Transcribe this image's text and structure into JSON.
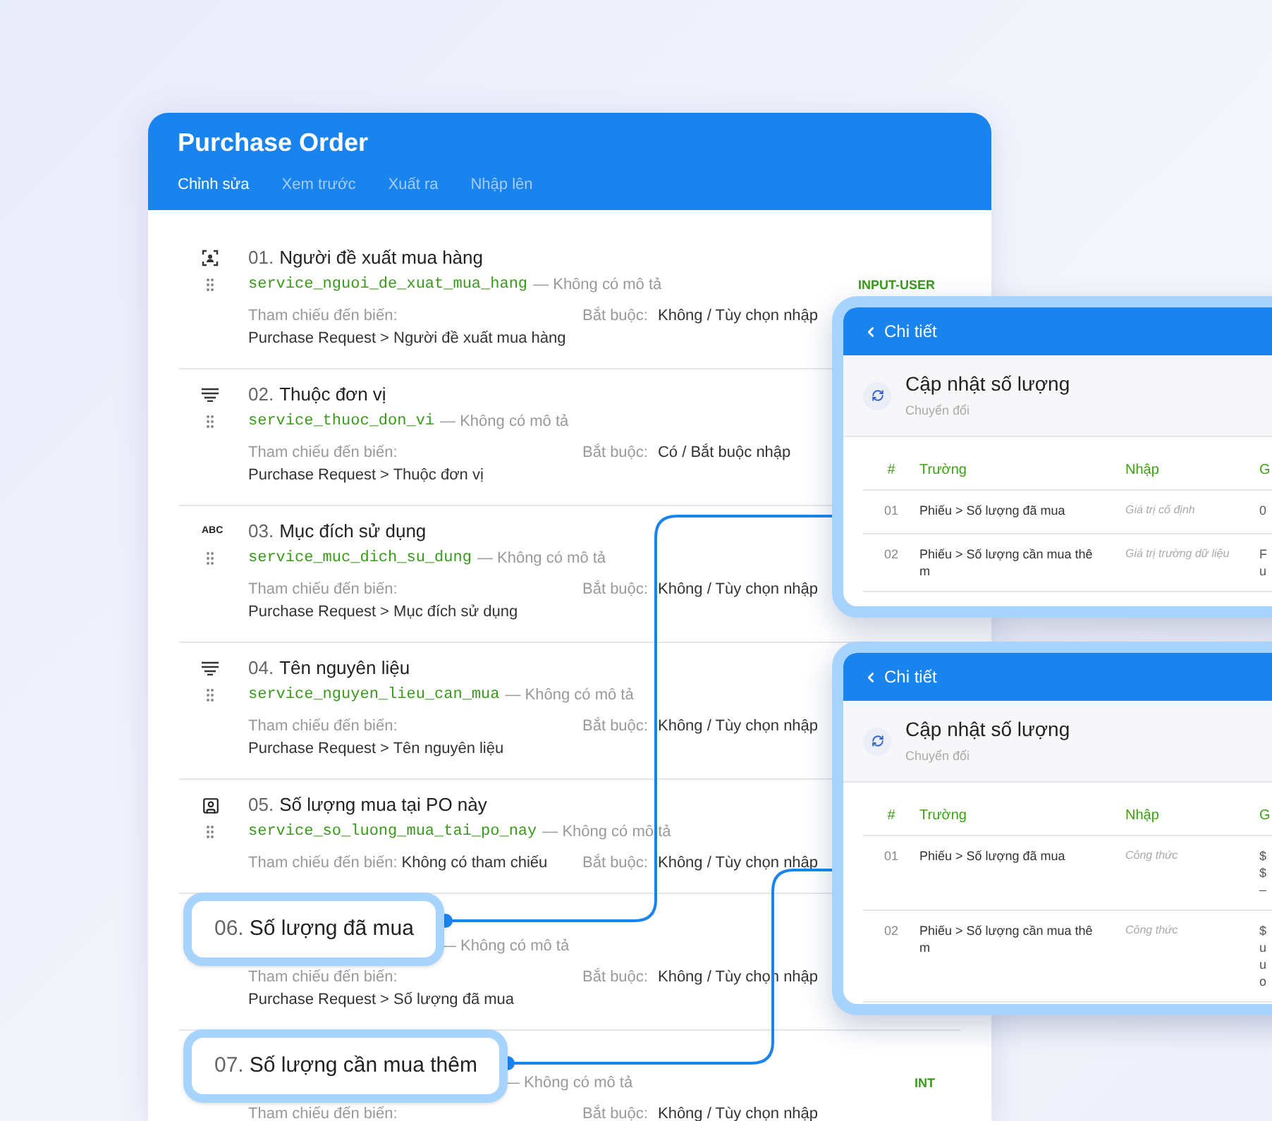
{
  "app": {
    "title": "Purchase Order",
    "tabs": [
      {
        "label": "Chỉnh sửa",
        "selected": true
      },
      {
        "label": "Xem trước",
        "selected": false
      },
      {
        "label": "Xuất ra",
        "selected": false
      },
      {
        "label": "Nhập lên",
        "selected": false
      }
    ]
  },
  "fields": [
    {
      "number": "01.",
      "title": "Người đề xuất mua hàng",
      "icon": {
        "kind": "user-scan"
      },
      "code": "service_nguoi_de_xuat_mua_hang",
      "description": "— Không có mô tả",
      "reference_label": "Tham chiếu đến biến:",
      "reference": "Purchase Request > Người đề xuất mua hàng",
      "reference_inline": false,
      "required_label": "Bắt buộc:",
      "required": "Không / Tùy chọn nhập",
      "type": "INPUT-USER",
      "highlighted": false
    },
    {
      "number": "02.",
      "title": "Thuộc đơn vị",
      "icon": {
        "kind": "lines"
      },
      "code": "service_thuoc_don_vi",
      "description": "— Không có mô tả",
      "reference_label": "Tham chiếu đến biến:",
      "reference": "Purchase Request > Thuộc đơn vị",
      "reference_inline": false,
      "required_label": "Bắt buộc:",
      "required": "Có / Bắt buộc nhập",
      "highlighted": false
    },
    {
      "number": "03.",
      "title": "Mục đích sử dụng",
      "icon": {
        "kind": "text",
        "text": "ABC"
      },
      "code": "service_muc_dich_su_dung",
      "description": "— Không có mô tả",
      "reference_label": "Tham chiếu đến biến:",
      "reference": "Purchase Request > Mục đích sử dụng",
      "reference_inline": false,
      "required_label": "Bắt buộc:",
      "required": "Không / Tùy chọn nhập",
      "highlighted": false
    },
    {
      "number": "04.",
      "title": "Tên nguyên liệu",
      "icon": {
        "kind": "lines"
      },
      "code": "service_nguyen_lieu_can_mua",
      "description": "— Không có mô tả",
      "reference_label": "Tham chiếu đến biến:",
      "reference": "Purchase Request > Tên nguyên liệu",
      "reference_inline": false,
      "required_label": "Bắt buộc:",
      "required": "Không / Tùy chọn nhập",
      "highlighted": false
    },
    {
      "number": "05.",
      "title": "Số lượng mua tại PO này",
      "icon": {
        "kind": "user-box"
      },
      "code": "service_so_luong_mua_tai_po_nay",
      "description": "— Không có mô tả",
      "reference_label": "Tham chiếu đến biến:",
      "reference": "Không có tham chiếu",
      "reference_inline": true,
      "required_label": "Bắt buộc:",
      "required": "Không / Tùy chọn nhập",
      "highlighted": false
    },
    {
      "number": "06.",
      "title": "Số lượng đã mua",
      "description": "— Không có mô tả",
      "reference_label": "Tham chiếu đến biến:",
      "reference": "Purchase Request > Số lượng đã mua",
      "reference_inline": false,
      "required_label": "Bắt buộc:",
      "required": "Không / Tùy chọn nhập",
      "highlighted": true
    },
    {
      "number": "07.",
      "title": "Số lượng cần mua thêm",
      "description": "— Không có mô tả",
      "reference_label": "Tham chiếu đến biến:",
      "reference_inline": false,
      "required_label": "Bắt buộc:",
      "required": "Không / Tùy chọn nhập",
      "type": "INT",
      "highlighted": true
    }
  ],
  "detail_panels": [
    {
      "back_label": "Chi tiết",
      "title": "Cập nhật số lượng",
      "subtitle": "Chuyển đổi",
      "columns": [
        "#",
        "Trường",
        "Nhập",
        "G"
      ],
      "rows": [
        {
          "index": "01",
          "field": "Phiếu > Số lượng đã mua",
          "input": "Giá trị cố định",
          "column_4": [
            "0"
          ]
        },
        {
          "index": "02",
          "field": "Phiếu > Số lượng cần mua thêm",
          "input": "Giá trị trường dữ liệu",
          "column_4": [
            "F",
            "u"
          ]
        }
      ]
    },
    {
      "back_label": "Chi tiết",
      "title": "Cập nhật số lượng",
      "subtitle": "Chuyển đổi",
      "columns": [
        "#",
        "Trường",
        "Nhập",
        "G"
      ],
      "rows": [
        {
          "index": "01",
          "field": "Phiếu > Số lượng đã mua",
          "input": "Công thức",
          "column_4": [
            "$",
            "$",
            "–"
          ]
        },
        {
          "index": "02",
          "field": "Phiếu > Số lượng cần mua thêm",
          "input": "Công thức",
          "column_4": [
            "$",
            "u",
            "u",
            "o"
          ]
        }
      ]
    }
  ]
}
